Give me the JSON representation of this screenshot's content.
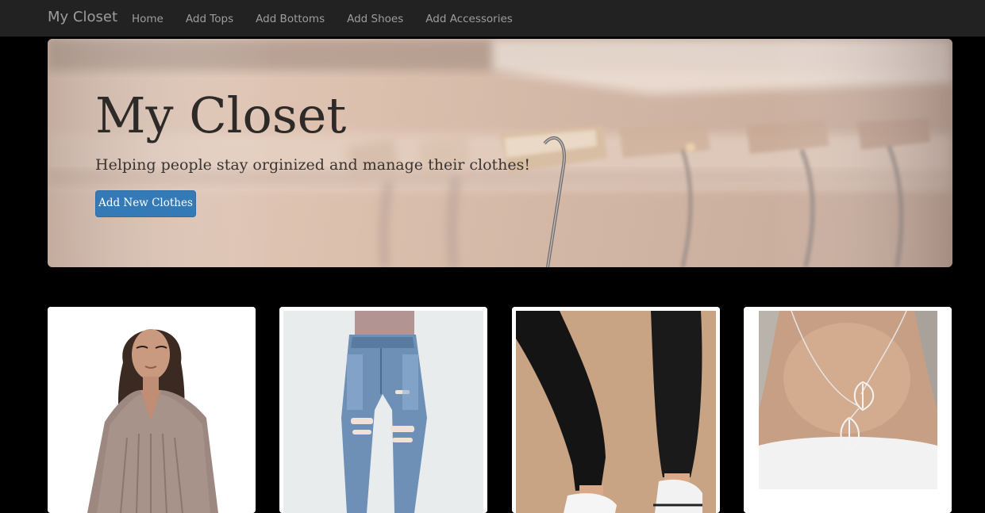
{
  "navbar": {
    "brand": "My Closet",
    "links": [
      "Home",
      "Add Tops",
      "Add Bottoms",
      "Add Shoes",
      "Add Accessories"
    ]
  },
  "jumbotron": {
    "title": "My Closet",
    "subtitle": "Helping people stay orginized and manage their clothes!",
    "button_label": "Add New Clothes"
  },
  "cards": [
    {
      "image": "woman-in-taupe-blouse"
    },
    {
      "image": "ripped-blue-jeans"
    },
    {
      "image": "black-leggings-with-sneakers"
    },
    {
      "image": "silver-leaf-necklace"
    }
  ],
  "colors": {
    "navbar_bg": "#222222",
    "nav_text": "#9d9d9d",
    "page_bg": "#000000",
    "primary_button": "#337ab7"
  }
}
